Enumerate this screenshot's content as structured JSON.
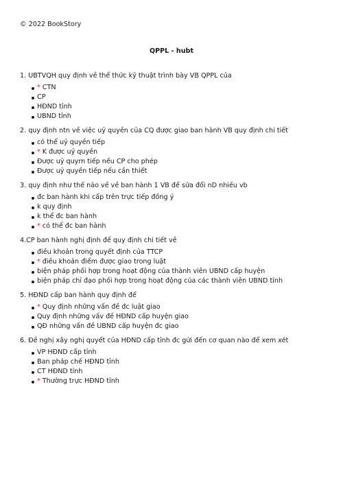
{
  "copyright": "© 2022 BookStory",
  "title": "QPPL - hubt",
  "correct_marker": "*",
  "accent_color": "#e0242b",
  "questions": [
    {
      "text": "1. UBTVQH quy định về thể thức kỹ thuật trình bày VB QPPL của",
      "answers": [
        {
          "text": "CTN",
          "correct": true
        },
        {
          "text": "CP",
          "correct": false
        },
        {
          "text": "HĐND tỉnh",
          "correct": false
        },
        {
          "text": "UBND tỉnh",
          "correct": false
        }
      ]
    },
    {
      "text": "2. quy định ntn về việc uỷ quyền của CQ được giao ban hành VB quy định chi tiết",
      "answers": [
        {
          "text": "có thể uỷ quyền tiếp",
          "correct": false
        },
        {
          "text": "K được uỷ quyền",
          "correct": true
        },
        {
          "text": "Được uỷ quyrn tiếp nếu CP cho phép",
          "correct": false
        },
        {
          "text": "Được uỷ quyền tiếp nếu cần thiết",
          "correct": false
        }
      ]
    },
    {
      "text": "3. quy định như thế nào về về ban hành 1 VB để sửa đổi nD nhiều vb",
      "answers": [
        {
          "text": "đc ban hành khi cấp trên trực tiếp đồng ý",
          "correct": false
        },
        {
          "text": "k quy định",
          "correct": false
        },
        {
          "text": "k thể đc ban hành",
          "correct": false
        },
        {
          "text": "có thể đc ban hành",
          "correct": true
        }
      ]
    },
    {
      "text": "4.CP ban hành nghị định để quy định chi tiết về",
      "answers": [
        {
          "text": "điều khoản trong quyết định của TTCP",
          "correct": false
        },
        {
          "text": "điều khoản điểm được giao trong luật",
          "correct": true
        },
        {
          "text": "biện pháp phối hợp trong hoạt động của thành viên UBND cấp huyện",
          "correct": false
        },
        {
          "text": "biện pháp chỉ đạo phối hợp trong hoạt động của các thành viên UBND tỉnh",
          "correct": false
        }
      ]
    },
    {
      "text": "5. HĐND cấp ban hành quy định để",
      "answers": [
        {
          "text": "Quy định những vấn đề đc luật giao",
          "correct": true
        },
        {
          "text": "Quy định những vấv đề HĐND cấp huyện giao",
          "correct": false
        },
        {
          "text": "QĐ những vấn đề UBND cấp huyện đc giao",
          "correct": false
        }
      ]
    },
    {
      "text": "6. Đề nghị xây nghị quyết của HĐND cấp tỉnh đc gửi đến cơ quan nào để xem xét",
      "answers": [
        {
          "text": "VP HĐND cấp tỉnh",
          "correct": false
        },
        {
          "text": "Ban pháp chế HĐND tỉnh",
          "correct": false
        },
        {
          "text": "CT HĐND tỉnh",
          "correct": false
        },
        {
          "text": "Thường trực HĐND tỉnh",
          "correct": true
        }
      ]
    }
  ]
}
